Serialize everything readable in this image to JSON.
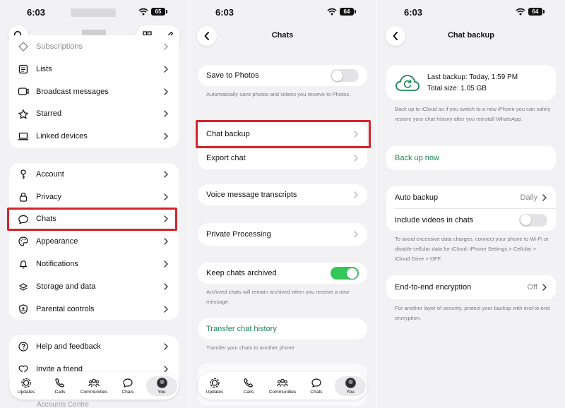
{
  "status_bar": {
    "time": "6:03",
    "battery_left": "65",
    "battery_mid": "64",
    "battery_right": "64"
  },
  "colors": {
    "accent_green": "#1b8755",
    "toggle_on": "#32c759",
    "highlight_red": "#d4232c"
  },
  "panel_settings": {
    "top_items": [
      {
        "label": "Subscriptions",
        "icon": "subscriptions-icon"
      },
      {
        "label": "Lists",
        "icon": "lists-icon"
      },
      {
        "label": "Broadcast messages",
        "icon": "broadcast-icon"
      },
      {
        "label": "Starred",
        "icon": "star-icon"
      },
      {
        "label": "Linked devices",
        "icon": "laptop-icon"
      }
    ],
    "main_items": [
      {
        "label": "Account",
        "icon": "key-icon"
      },
      {
        "label": "Privacy",
        "icon": "lock-icon"
      },
      {
        "label": "Chats",
        "icon": "chat-bubble-icon"
      },
      {
        "label": "Appearance",
        "icon": "palette-icon"
      },
      {
        "label": "Notifications",
        "icon": "bell-icon"
      },
      {
        "label": "Storage and data",
        "icon": "storage-icon"
      },
      {
        "label": "Parental controls",
        "icon": "shield-icon"
      }
    ],
    "help_items": [
      {
        "label": "Help and feedback",
        "icon": "help-icon"
      },
      {
        "label": "Invite a friend",
        "icon": "heart-icon"
      }
    ],
    "accounts_centre": "Accounts Centre"
  },
  "panel_chats": {
    "title": "Chats",
    "save_to_photos": "Save to Photos",
    "save_to_photos_note": "Automatically save photos and videos you receive to Photos.",
    "chat_backup": "Chat backup",
    "export_chat": "Export chat",
    "voice_transcripts": "Voice message transcripts",
    "private_processing": "Private Processing",
    "keep_archived": "Keep chats archived",
    "keep_archived_note": "Archived chats will remain archived when you receive a new message.",
    "transfer_history": "Transfer chat history",
    "transfer_note": "Transfer your chats to another phone"
  },
  "panel_backup": {
    "title": "Chat backup",
    "last_backup": "Last backup: Today, 1:59 PM",
    "total_size": "Total size: 1.05 GB",
    "icloud_note": "Back up to iCloud so if you switch to a new iPhone you can safely restore your chat history after you reinstall WhatsApp.",
    "back_up_now": "Back up now",
    "auto_backup": "Auto backup",
    "auto_backup_value": "Daily",
    "include_videos": "Include videos in chats",
    "data_note": "To avoid excessive data charges, connect your phone to Wi-Fi or disable cellular data for iCloud: iPhone Settings > Cellular > iCloud Drive > OFF.",
    "e2e": "End-to-end encryption",
    "e2e_value": "Off",
    "e2e_note": "For another layer of security, protect your backup with end-to-end encryption."
  },
  "tabbar": {
    "updates": "Updates",
    "calls": "Calls",
    "communities": "Communities",
    "chats": "Chats",
    "you": "You"
  }
}
